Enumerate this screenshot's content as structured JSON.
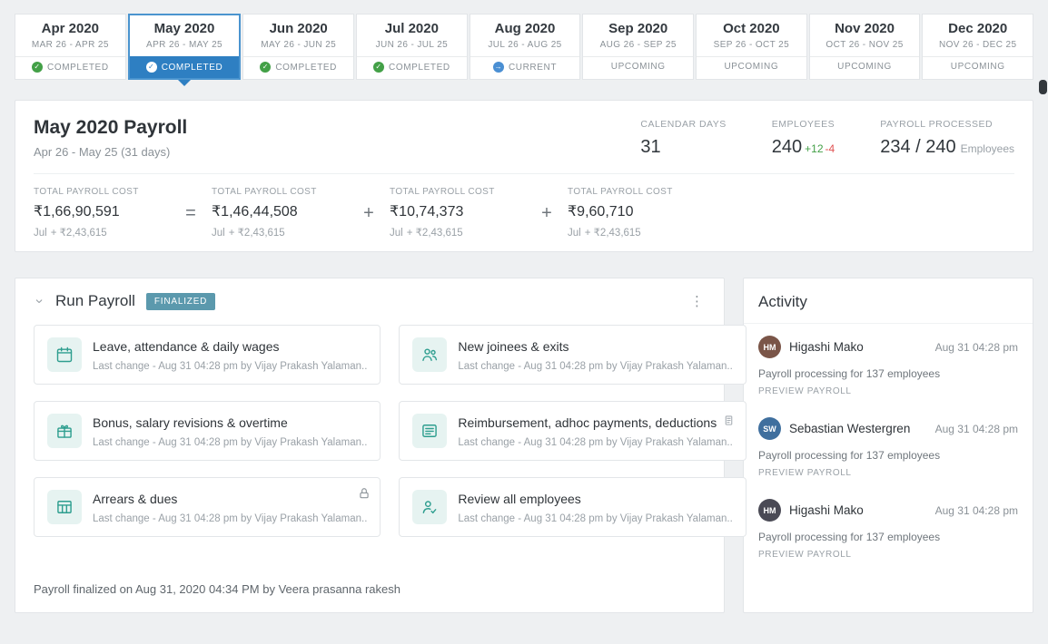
{
  "colors": {
    "accent_blue": "#2e7fc2",
    "completed_green": "#43a047",
    "current_blue": "#4a8fd3",
    "finalized_badge_teal": "#5b99ad",
    "tile_icon_teal": "#2e9e8f",
    "delta_green": "#43a047",
    "delta_red": "#e05252"
  },
  "timeline": {
    "months": [
      {
        "title": "Apr 2020",
        "range": "MAR 26 - APR 25",
        "status": "COMPLETED"
      },
      {
        "title": "May 2020",
        "range": "APR 26 - MAY 25",
        "status": "COMPLETED"
      },
      {
        "title": "Jun 2020",
        "range": "MAY 26 - JUN 25",
        "status": "COMPLETED"
      },
      {
        "title": "Jul 2020",
        "range": "JUN 26 - JUL 25",
        "status": "COMPLETED"
      },
      {
        "title": "Aug 2020",
        "range": "JUL 26 - AUG 25",
        "status": "CURRENT"
      },
      {
        "title": "Sep 2020",
        "range": "AUG 26 - SEP 25",
        "status": "UPCOMING"
      },
      {
        "title": "Oct 2020",
        "range": "SEP 26 - OCT 25",
        "status": "UPCOMING"
      },
      {
        "title": "Nov 2020",
        "range": "OCT 26 - NOV 25",
        "status": "UPCOMING"
      },
      {
        "title": "Dec 2020",
        "range": "NOV 26 - DEC 25",
        "status": "UPCOMING"
      }
    ]
  },
  "summary": {
    "title": "May 2020 Payroll",
    "subtitle": "Apr 26 - May 25 (31 days)",
    "stats": [
      {
        "label": "CALENDAR DAYS",
        "value": "31"
      },
      {
        "label": "EMPLOYEES",
        "value": "240",
        "delta_plus": "+12",
        "delta_minus": "-4"
      },
      {
        "label": "PAYROLL PROCESSED",
        "value": "234 / 240",
        "suffix": "Employees"
      }
    ],
    "costs": [
      {
        "label": "TOTAL PAYROLL COST",
        "amount": "₹1,66,90,591",
        "month": "Jul",
        "delta": "+ ₹2,43,615"
      },
      {
        "label": "TOTAL PAYROLL COST",
        "amount": "₹1,46,44,508",
        "month": "Jul",
        "delta": "+ ₹2,43,615"
      },
      {
        "label": "TOTAL PAYROLL COST",
        "amount": "₹10,74,373",
        "month": "Jul",
        "delta": "+ ₹2,43,615"
      },
      {
        "label": "TOTAL PAYROLL COST",
        "amount": "₹9,60,710",
        "month": "Jul",
        "delta": "+ ₹2,43,615"
      }
    ],
    "operators": [
      "=",
      "+",
      "+"
    ]
  },
  "run_payroll": {
    "title": "Run Payroll",
    "badge": "FINALIZED",
    "steps": [
      {
        "title": "Leave, attendance & daily wages",
        "subtitle": "Last change - Aug 31 04:28 pm by Vijay Prakash Yalaman..",
        "icon": "calendar-icon"
      },
      {
        "title": "New joinees & exits",
        "subtitle": "Last change - Aug 31 04:28 pm by Vijay Prakash Yalaman..",
        "icon": "people-icon"
      },
      {
        "title": "Bonus, salary revisions & overtime",
        "subtitle": "Last change - Aug 31 04:28 pm by Vijay Prakash Yalaman..",
        "icon": "gift-icon"
      },
      {
        "title": "Reimbursement, adhoc payments, deductions",
        "subtitle": "Last change - Aug 31 04:28 pm by Vijay Prakash Yalaman..",
        "icon": "receipt-icon"
      },
      {
        "title": "Arrears & dues",
        "subtitle": "Last change - Aug 31 04:28 pm by Vijay Prakash Yalaman..",
        "icon": "table-icon",
        "locked": true
      },
      {
        "title": "Review all employees",
        "subtitle": "Last change - Aug 31 04:28 pm by Vijay Prakash Yalaman..",
        "icon": "person-check-icon"
      }
    ],
    "footer": "Payroll finalized on Aug 31, 2020 04:34 PM by Veera prasanna rakesh"
  },
  "activity": {
    "title": "Activity",
    "items": [
      {
        "name": "Higashi Mako",
        "time": "Aug 31 04:28 pm",
        "description": "Payroll processing for 137 employees",
        "action": "PREVIEW PAYROLL",
        "initials": "HM"
      },
      {
        "name": "Sebastian Westergren",
        "time": "Aug 31 04:28 pm",
        "description": "Payroll processing for 137 employees",
        "action": "PREVIEW PAYROLL",
        "initials": "SW"
      },
      {
        "name": "Higashi Mako",
        "time": "Aug 31 04:28 pm",
        "description": "Payroll processing for 137 employees",
        "action": "PREVIEW PAYROLL",
        "initials": "HM"
      }
    ]
  }
}
